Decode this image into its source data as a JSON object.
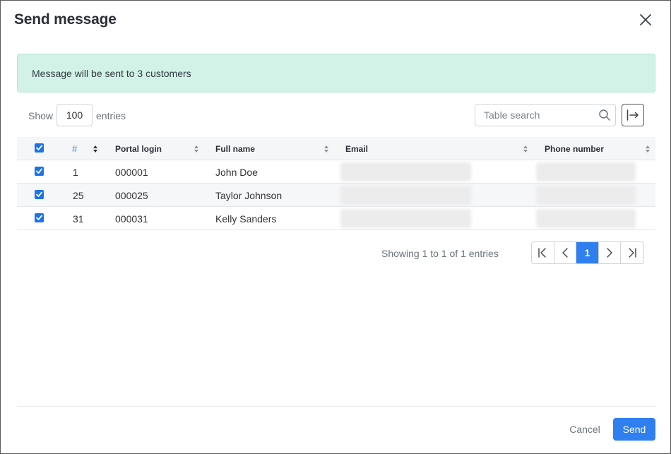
{
  "dialog": {
    "title": "Send message",
    "close_icon": "close-icon"
  },
  "alert": {
    "text": "Message will be sent to 3 customers",
    "color": "#d3f2e7"
  },
  "controls": {
    "show_label": "Show",
    "entries_value": "100",
    "entries_label": "entries",
    "search_placeholder": "Table search",
    "search_icon": "search-icon",
    "export_icon": "export-icon"
  },
  "table": {
    "columns": {
      "select": "select-all-checkbox",
      "id": "#",
      "portal_login": "Portal login",
      "full_name": "Full name",
      "email": "Email",
      "phone": "Phone number"
    },
    "rows": [
      {
        "checked": true,
        "id": "1",
        "portal_login": "000001",
        "full_name": "John Doe"
      },
      {
        "checked": true,
        "id": "25",
        "portal_login": "000025",
        "full_name": "Taylor Johnson"
      },
      {
        "checked": true,
        "id": "31",
        "portal_login": "000031",
        "full_name": "Kelly Sanders"
      }
    ]
  },
  "pagination": {
    "info": "Showing 1 to 1 of 1 entries",
    "current_page": "1",
    "first_icon": "first-page-icon",
    "prev_icon": "prev-page-icon",
    "next_icon": "next-page-icon",
    "last_icon": "last-page-icon"
  },
  "footer": {
    "cancel_label": "Cancel",
    "send_label": "Send"
  },
  "colors": {
    "accent": "#2f7ff0",
    "checkbox": "#1a73e8",
    "header_bg": "#f5f6f8"
  }
}
